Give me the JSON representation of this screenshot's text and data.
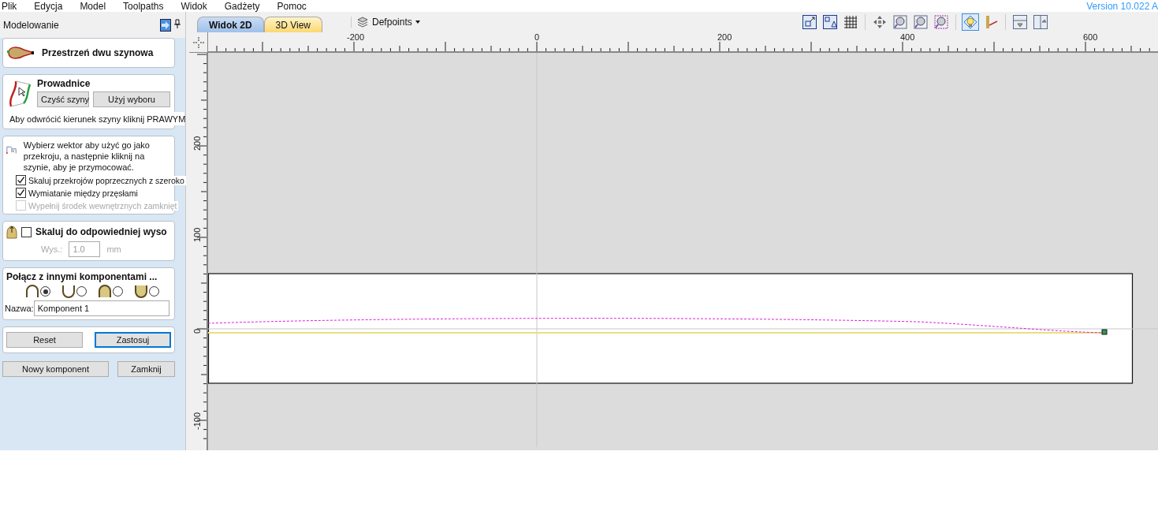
{
  "menu": [
    "Plik",
    "Edycja",
    "Model",
    "Toolpaths",
    "Widok",
    "Gadżety",
    "Pomoc"
  ],
  "version": "Version 10.022 A",
  "panel": {
    "title": "Modelowanie",
    "header": "Przestrzeń dwu szynowa",
    "rails": {
      "title": "Prowadnice",
      "buttons": [
        "Czyść szyny",
        "Użyj wyboru"
      ],
      "hint": "Aby odwrócić kierunek szyny kliknij  PRAWYM"
    },
    "section": {
      "text": "Wybierz wektor aby użyć go jako przekroju, a następnie kliknij na szynie, aby je przymocować.",
      "options": [
        {
          "label": "Skaluj przekrojów poprzecznych z szeroko",
          "checked": true,
          "disabled": false
        },
        {
          "label": "Wymiatanie między przęsłami",
          "checked": true,
          "disabled": false
        },
        {
          "label": "Wypełnij środek wewnętrznych zamknięt",
          "checked": false,
          "disabled": true
        }
      ]
    },
    "scale": {
      "label": "Skaluj do odpowiedniej wyso",
      "checked": false,
      "height_label": "Wys.:",
      "height_value": "1.0",
      "unit": "mm"
    },
    "join": {
      "title": "Połącz z innymi komponentami ...",
      "options": [
        {
          "kind": "arch",
          "filled": false,
          "selected": true
        },
        {
          "kind": "cup",
          "filled": false,
          "selected": false
        },
        {
          "kind": "arch",
          "filled": true,
          "selected": false
        },
        {
          "kind": "cup",
          "filled": true,
          "selected": false
        }
      ],
      "name_label": "Nazwa:",
      "name_value": "Komponent 1"
    },
    "actions": [
      {
        "label": "Reset",
        "selected": false
      },
      {
        "label": "Zastosuj",
        "selected": true
      }
    ],
    "footer": [
      "Nowy komponent",
      "Zamknij"
    ]
  },
  "tabs": [
    {
      "label": "Widok 2D",
      "selected": true
    },
    {
      "label": "3D View",
      "selected": false
    }
  ],
  "layer": "Defpoints",
  "toolbar": [
    {
      "tools": [
        {
          "kind": "fit",
          "selected": false
        },
        {
          "kind": "snap",
          "selected": false
        },
        {
          "kind": "grid",
          "selected": false
        }
      ]
    },
    {
      "tools": [
        {
          "kind": "pan",
          "selected": false
        },
        {
          "kind": "zoom-box",
          "selected": false
        },
        {
          "kind": "zoom-fit",
          "selected": false
        },
        {
          "kind": "zoom-selection",
          "selected": false
        }
      ]
    },
    {
      "tools": [
        {
          "kind": "light",
          "selected": true
        },
        {
          "kind": "measure",
          "selected": false
        }
      ]
    },
    {
      "tools": [
        {
          "kind": "layout-top",
          "selected": false
        },
        {
          "kind": "layout-side",
          "selected": false
        }
      ]
    }
  ],
  "rulers": {
    "horizontal": [
      "-200",
      "0",
      "200",
      "400",
      "600"
    ],
    "vertical": [
      "200",
      "100",
      "0",
      "-100"
    ]
  }
}
